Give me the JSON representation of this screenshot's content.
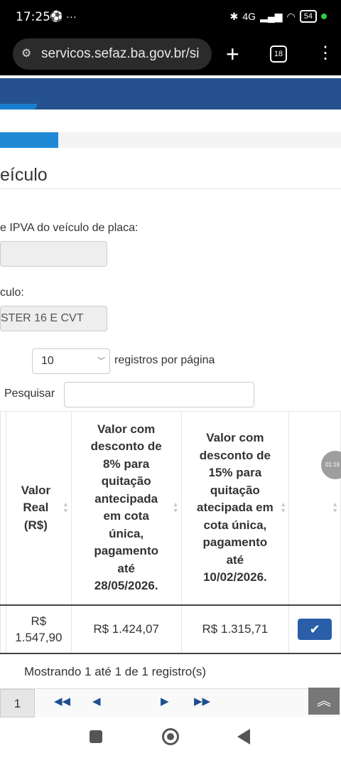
{
  "status_bar": {
    "time": "17:25",
    "left_icons": "⚽ ···",
    "network": "4G",
    "battery": "54"
  },
  "browser": {
    "url": "servicos.sefaz.ba.gov.br/si",
    "tab_count": "18"
  },
  "wizard": {
    "progress_fraction": 0.17
  },
  "form": {
    "section_title": "eículo",
    "plate_label": "e IPVA do veículo de placa:",
    "plate_value": "",
    "model_label": "culo:",
    "model_value": "STER 16 E CVT"
  },
  "table_controls": {
    "page_size": "10",
    "page_size_suffix": "registros por página",
    "search_label": "Pesquisar",
    "search_value": ""
  },
  "table": {
    "headers": [
      "Valor Real (R$)",
      "Valor com desconto de 8% para quitação antecipada em cota única, pagamento até 28/05/2026.",
      "Valor com desconto de 15% para quitação atecipada em cota única, pagamento até 10/02/2026.",
      ""
    ],
    "rows": [
      {
        "valor_real": "R$ 1.547,90",
        "desconto_8": "R$ 1.424,07",
        "desconto_15": "R$ 1.315,71"
      }
    ],
    "timer_badge": "01:16"
  },
  "footer": {
    "info": "Mostrando 1 até 1 de 1 registro(s)",
    "current_page": "1"
  },
  "colors": {
    "nav_blue": "#25528f",
    "progress_blue": "#1e8ad6",
    "button_blue": "#2a5fa8"
  }
}
